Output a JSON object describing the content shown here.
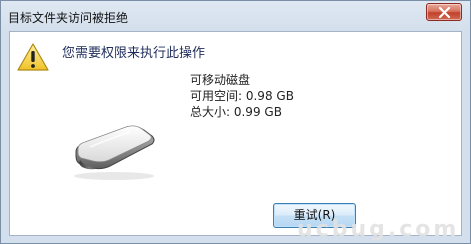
{
  "window": {
    "title": "目标文件夹访问被拒绝"
  },
  "dialog": {
    "message": "您需要权限来执行此操作",
    "drive_name": "可移动磁盘",
    "free_space": "可用空间: 0.98 GB",
    "total_size": "总大小: 0.99 GB",
    "retry_label": "重试(R)"
  },
  "watermark": "ucbug.com",
  "icons": {
    "warning": "warning-icon",
    "drive": "removable-drive-icon",
    "close": "close-icon"
  },
  "colors": {
    "titlebar": "#dfe8f2",
    "close_button": "#c2412b",
    "warning_yellow": "#f6d33c",
    "retry_button": "#c4e0f6"
  }
}
